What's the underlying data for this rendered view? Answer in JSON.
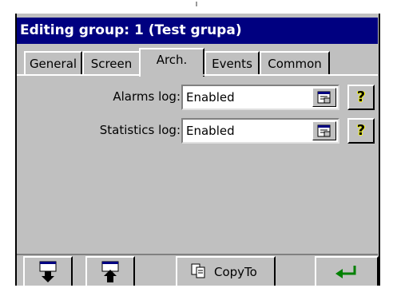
{
  "window": {
    "title": "Editing group: 1 (Test grupa)"
  },
  "tabs": [
    {
      "label": "General"
    },
    {
      "label": "Screen"
    },
    {
      "label": "Arch."
    },
    {
      "label": "Events"
    },
    {
      "label": "Common"
    }
  ],
  "active_tab": "Arch.",
  "rows": [
    {
      "label": "Alarms log:",
      "value": "Enabled"
    },
    {
      "label": "Statistics log:",
      "value": "Enabled"
    }
  ],
  "help_glyph": "?",
  "bottom": {
    "copyto_label": "CopyTo",
    "buttons": [
      "import-icon",
      "export-icon",
      "copy-icon",
      "enter-icon"
    ]
  },
  "colors": {
    "titlebar": "#000080",
    "face": "#c0c0c0",
    "enter_arrow": "#008000",
    "help_yellow": "#ffff00"
  }
}
